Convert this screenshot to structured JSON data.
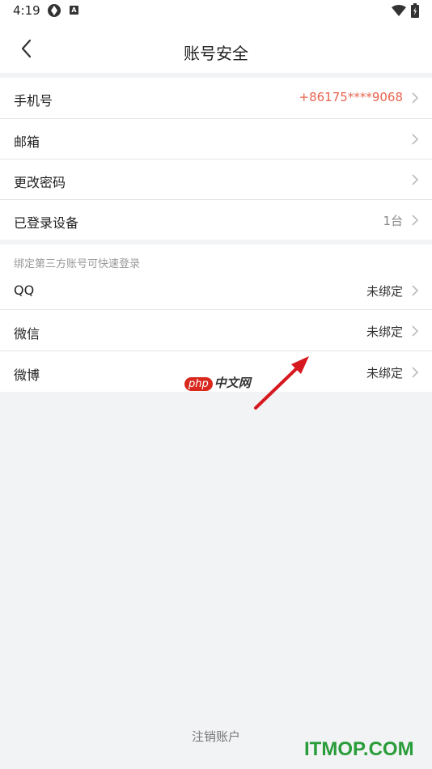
{
  "status_bar": {
    "time": "4:19",
    "icon_a": "A"
  },
  "header": {
    "title": "账号安全"
  },
  "account": {
    "phone": {
      "label": "手机号",
      "value": "+86175****9068"
    },
    "email": {
      "label": "邮箱"
    },
    "password": {
      "label": "更改密码"
    },
    "devices": {
      "label": "已登录设备",
      "value": "1台"
    }
  },
  "third_party": {
    "hint": "绑定第三方账号可快速登录",
    "items": [
      {
        "label": "QQ",
        "status": "未绑定"
      },
      {
        "label": "微信",
        "status": "未绑定"
      },
      {
        "label": "微博",
        "status": "未绑定"
      }
    ]
  },
  "watermark": {
    "php": "php",
    "site": "中文网"
  },
  "footer": {
    "cancel_account": "注销账户"
  },
  "brand": "ITMOP.COM",
  "colors": {
    "accent_red": "#e8644f",
    "background": "#f1f3f4",
    "arrow": "#d6191f",
    "brand_green": "#2a9d3a"
  },
  "icons": [
    "back-arrow-icon",
    "chevron-right-icon",
    "wifi-icon",
    "battery-icon",
    "sync-icon"
  ]
}
